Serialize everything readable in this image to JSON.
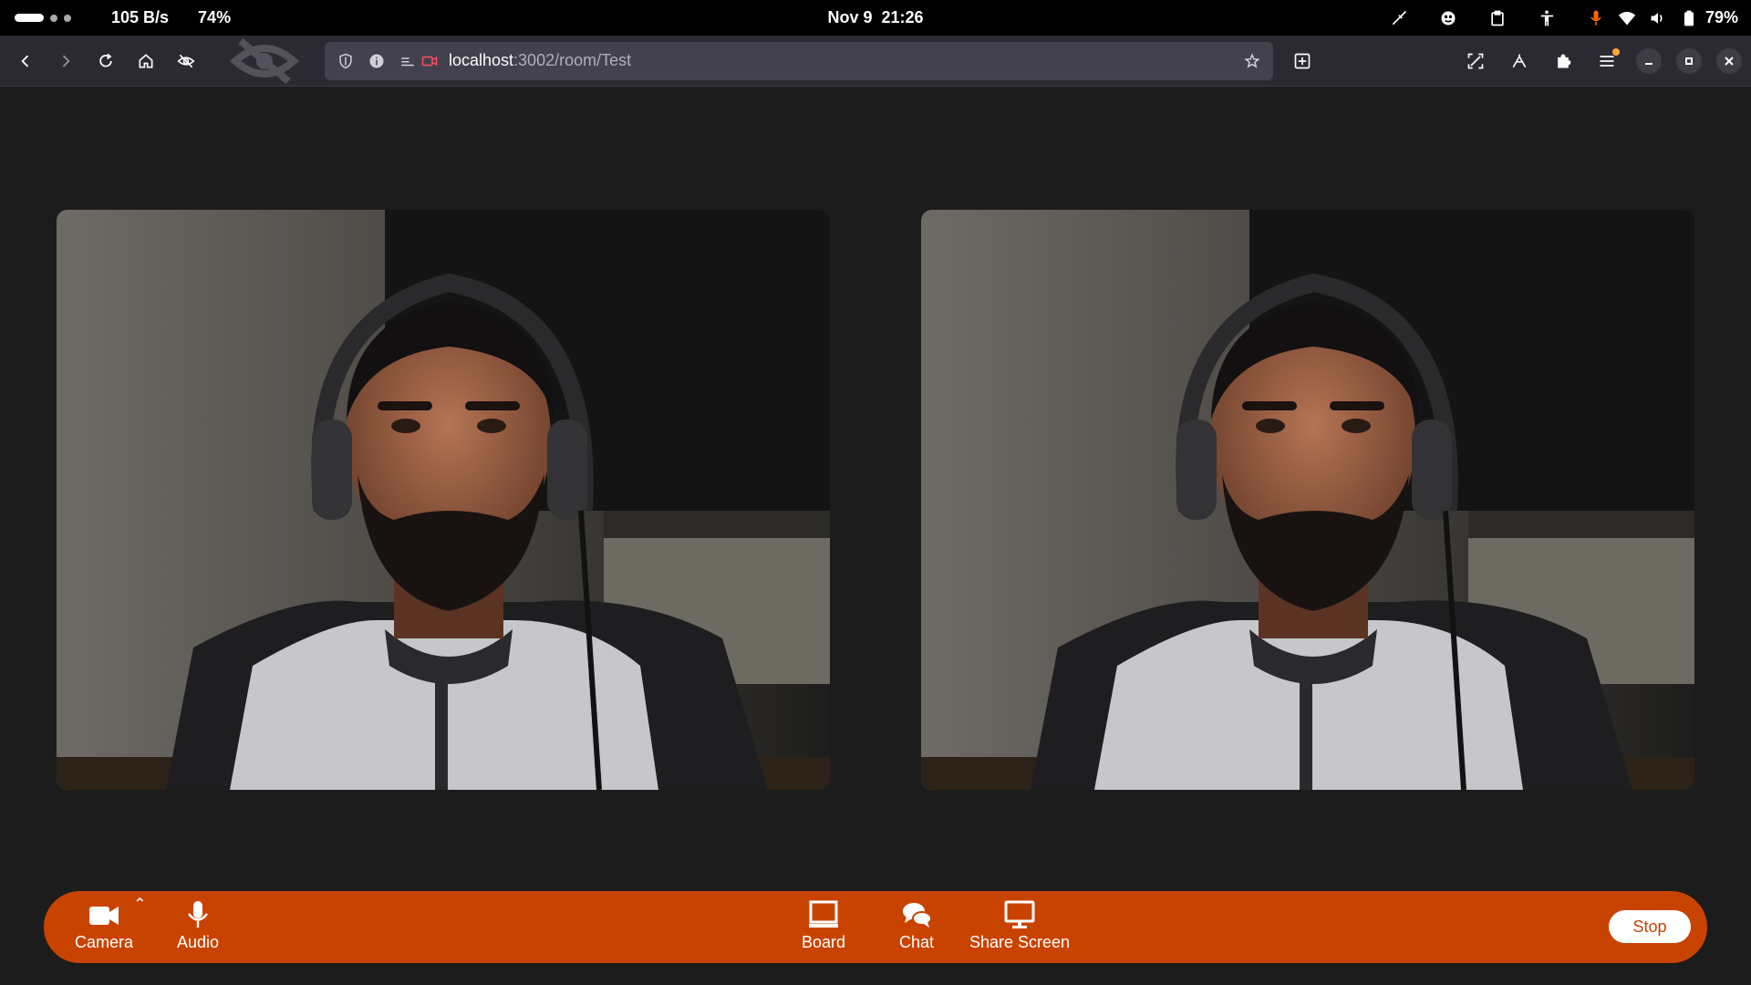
{
  "system_bar": {
    "network_speed": "105 B/s",
    "cpu_percent": "74%",
    "date": "Nov 9",
    "time": "21:26",
    "battery_percent": "79%",
    "icons": [
      "color-picker-icon",
      "fan-icon",
      "clipboard-icon",
      "accessibility-icon",
      "microphone-icon",
      "wifi-icon",
      "volume-icon",
      "battery-icon"
    ],
    "microphone_color": "#ff6a00"
  },
  "browser": {
    "url_host": "localhost",
    "url_rest": ":3002/room/Test",
    "nav_icons": [
      "back-icon",
      "forward-icon",
      "reload-icon",
      "home-icon",
      "tracking-protection-icon"
    ],
    "right_icons": [
      "screenshot-icon",
      "share-icon",
      "extensions-icon",
      "menu-icon"
    ]
  },
  "videos": [
    {
      "label": "local-video"
    },
    {
      "label": "remote-video"
    }
  ],
  "controls": {
    "accent": "#c94300",
    "camera_label": "Camera",
    "audio_label": "Audio",
    "board_label": "Board",
    "chat_label": "Chat",
    "share_label": "Share Screen",
    "stop_label": "Stop"
  }
}
